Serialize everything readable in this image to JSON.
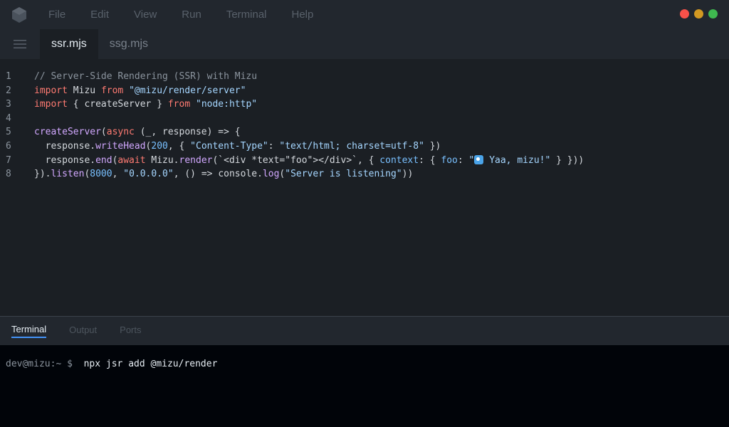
{
  "menubar": {
    "items": [
      "File",
      "Edit",
      "View",
      "Run",
      "Terminal",
      "Help"
    ],
    "traffic_colors": [
      "#f85149",
      "#d29922",
      "#3fb950"
    ]
  },
  "tabs": [
    {
      "label": "ssr.mjs",
      "active": true
    },
    {
      "label": "ssg.mjs",
      "active": false
    }
  ],
  "editor": {
    "line_numbers": [
      "1",
      "2",
      "3",
      "4",
      "5",
      "6",
      "7",
      "8"
    ],
    "lines": [
      [
        {
          "t": "// Server-Side Rendering (SSR) with Mizu",
          "c": "comment"
        }
      ],
      [
        {
          "t": "import",
          "c": "kw"
        },
        {
          "t": " Mizu ",
          "c": "plain"
        },
        {
          "t": "from",
          "c": "kw"
        },
        {
          "t": " ",
          "c": "plain"
        },
        {
          "t": "\"@mizu/render/server\"",
          "c": "str"
        }
      ],
      [
        {
          "t": "import",
          "c": "kw"
        },
        {
          "t": " { createServer } ",
          "c": "plain"
        },
        {
          "t": "from",
          "c": "kw"
        },
        {
          "t": " ",
          "c": "plain"
        },
        {
          "t": "\"node:http\"",
          "c": "str"
        }
      ],
      [],
      [
        {
          "t": "createServer",
          "c": "fn"
        },
        {
          "t": "(",
          "c": "plain"
        },
        {
          "t": "async",
          "c": "kw"
        },
        {
          "t": " (_, response) => {",
          "c": "plain"
        }
      ],
      [
        {
          "t": "  response.",
          "c": "plain"
        },
        {
          "t": "writeHead",
          "c": "fn"
        },
        {
          "t": "(",
          "c": "plain"
        },
        {
          "t": "200",
          "c": "num"
        },
        {
          "t": ", { ",
          "c": "plain"
        },
        {
          "t": "\"Content-Type\"",
          "c": "str"
        },
        {
          "t": ": ",
          "c": "plain"
        },
        {
          "t": "\"text/html; charset=utf-8\"",
          "c": "str"
        },
        {
          "t": " })",
          "c": "plain"
        }
      ],
      [
        {
          "t": "  response.",
          "c": "plain"
        },
        {
          "t": "end",
          "c": "fn"
        },
        {
          "t": "(",
          "c": "plain"
        },
        {
          "t": "await",
          "c": "kw"
        },
        {
          "t": " Mizu.",
          "c": "plain"
        },
        {
          "t": "render",
          "c": "fn"
        },
        {
          "t": "(`<div *text=\"foo\"></div>`, { ",
          "c": "plain"
        },
        {
          "t": "context",
          "c": "prop"
        },
        {
          "t": ": { ",
          "c": "plain"
        },
        {
          "t": "foo",
          "c": "prop"
        },
        {
          "t": ": ",
          "c": "plain"
        },
        {
          "t": "\"",
          "c": "str"
        },
        {
          "t": "",
          "c": "emoji"
        },
        {
          "t": " Yaa, mizu!\"",
          "c": "str"
        },
        {
          "t": " } }))",
          "c": "plain"
        }
      ],
      [
        {
          "t": "}).",
          "c": "plain"
        },
        {
          "t": "listen",
          "c": "fn"
        },
        {
          "t": "(",
          "c": "plain"
        },
        {
          "t": "8000",
          "c": "num"
        },
        {
          "t": ", ",
          "c": "plain"
        },
        {
          "t": "\"0.0.0.0\"",
          "c": "str"
        },
        {
          "t": ", () => console.",
          "c": "plain"
        },
        {
          "t": "log",
          "c": "fn"
        },
        {
          "t": "(",
          "c": "plain"
        },
        {
          "t": "\"Server is listening\"",
          "c": "str"
        },
        {
          "t": "))",
          "c": "plain"
        }
      ]
    ]
  },
  "panel": {
    "tabs": [
      {
        "label": "Terminal",
        "active": true
      },
      {
        "label": "Output",
        "active": false
      },
      {
        "label": "Ports",
        "active": false
      }
    ]
  },
  "terminal": {
    "prompt": "dev@mizu:~ $ ",
    "command": " npx jsr add @mizu/render"
  }
}
